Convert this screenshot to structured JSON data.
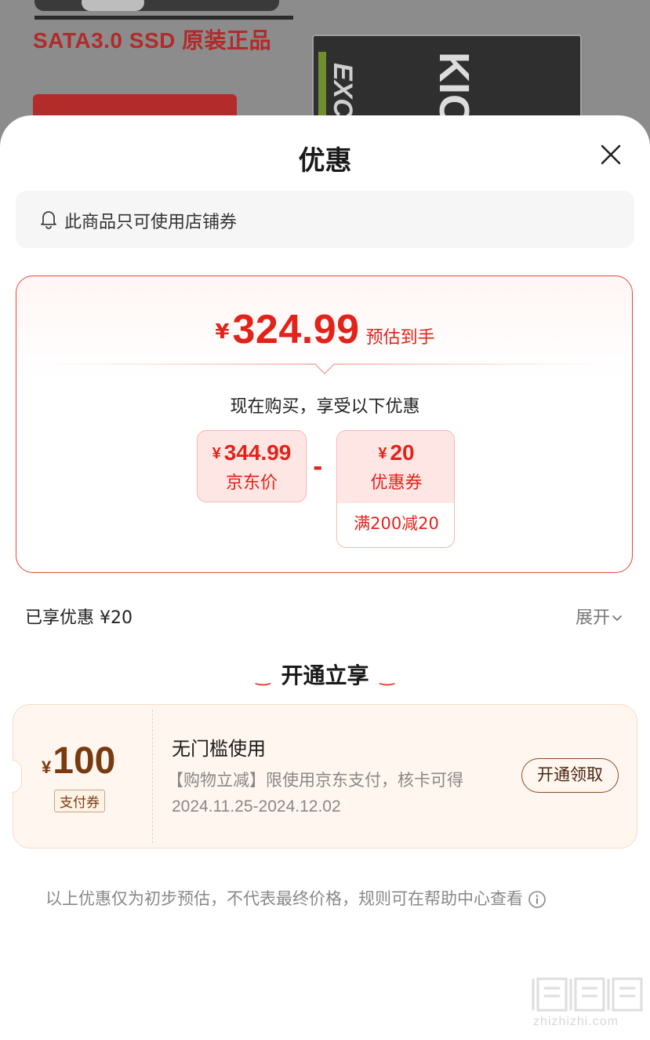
{
  "background": {
    "promo_text": "SATA3.0 SSD 原装正品",
    "product_brand_text": "EXCE",
    "product_brand_text2": "KIO"
  },
  "sheet": {
    "title": "优惠",
    "notice": "此商品只可使用店铺券",
    "price": {
      "currency": "¥",
      "amount": "324.99",
      "label": "预估到手"
    },
    "buy_line": "现在购买，享受以下优惠",
    "jd_price": {
      "currency": "¥",
      "amount": "344.99",
      "label": "京东价"
    },
    "minus": "-",
    "coupon": {
      "currency": "¥",
      "amount": "20",
      "label": "优惠券",
      "rule": "满200减20"
    },
    "enjoyed": "已享优惠 ¥20",
    "expand_label": "展开",
    "section_title": "开通立享",
    "section_deco": "‿",
    "pay_coupon": {
      "currency": "¥",
      "amount": "100",
      "tag": "支付券",
      "title": "无门槛使用",
      "desc": "【购物立减】限使用京东支付，核卡可得",
      "date_range": "2024.11.25-2024.12.02",
      "button": "开通领取"
    },
    "footer_note": "以上优惠仅为初步预估，不代表最终价格，规则可在帮助中心查看"
  },
  "watermark": {
    "text": "值值值",
    "site": "zhizhizhi.com"
  },
  "colors": {
    "accent_red": "#e2231a",
    "coupon_brown": "#7a3a10",
    "overlay_bg": "#8c8c8c"
  },
  "icons": [
    "close-icon",
    "bell-icon",
    "chevron-down-icon",
    "info-icon"
  ]
}
